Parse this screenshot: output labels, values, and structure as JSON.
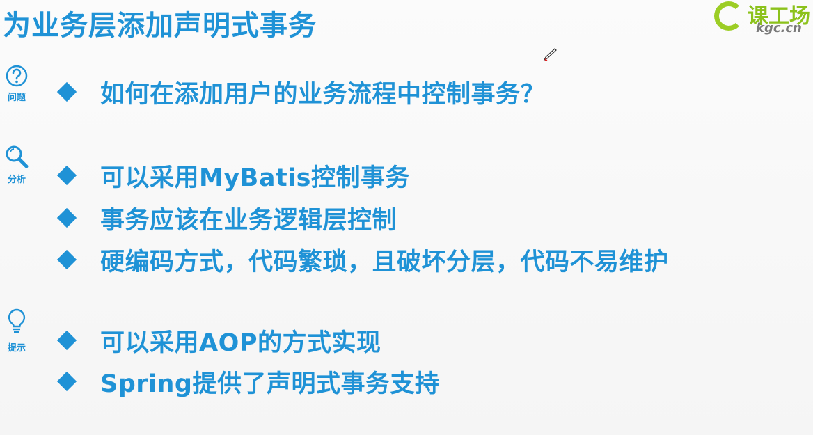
{
  "slide": {
    "title": "为业务层添加声明式事务",
    "logo": {
      "cn_text": "课工场",
      "en_text": "kgc.cn",
      "accent": "#9ccd25"
    },
    "accent_color": "#1f92d6"
  },
  "sections": [
    {
      "label": "问题",
      "icon": "question-mark-icon",
      "bullets": [
        "如何在添加用户的业务流程中控制事务？"
      ]
    },
    {
      "label": "分析",
      "icon": "magnifier-icon",
      "bullets": [
        "可以采用MyBatis控制事务",
        "事务应该在业务逻辑层控制",
        "硬编码方式，代码繁琐，且破坏分层，代码不易维护"
      ]
    },
    {
      "label": "提示",
      "icon": "lightbulb-icon",
      "bullets": [
        "可以采用AOP的方式实现",
        "Spring提供了声明式事务支持"
      ]
    }
  ]
}
